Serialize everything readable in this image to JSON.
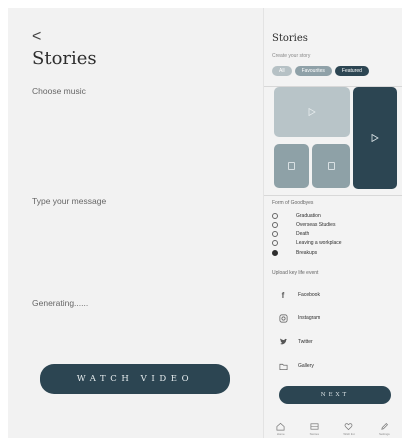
{
  "left": {
    "back_glyph": "<",
    "title": "Stories",
    "choose_music": "Choose music",
    "type_message": "Type your message",
    "generating": "Generating......",
    "watch_button": "WATCH VIDEO"
  },
  "right": {
    "title": "Stories",
    "subtitle": "Create your story",
    "tabs": [
      {
        "label": "All",
        "active": false
      },
      {
        "label": "Favourites",
        "active": false
      },
      {
        "label": "Featured",
        "active": true
      }
    ],
    "form_label": "Form of Goodbyes",
    "options": [
      {
        "label": "Graduation",
        "selected": false
      },
      {
        "label": "Overseas Studies",
        "selected": false
      },
      {
        "label": "Death",
        "selected": false
      },
      {
        "label": "Leaving a workplace",
        "selected": false
      },
      {
        "label": "Breakups",
        "selected": true
      }
    ],
    "upload_label": "Upload key life event",
    "socials": [
      {
        "label": "Facebook",
        "icon": "facebook-icon"
      },
      {
        "label": "Instagram",
        "icon": "instagram-icon"
      },
      {
        "label": "Twitter",
        "icon": "twitter-icon"
      },
      {
        "label": "Gallery",
        "icon": "folder-icon"
      }
    ],
    "next_button": "NEXT",
    "nav": [
      {
        "label": "Home",
        "icon": "home-icon"
      },
      {
        "label": "Stories",
        "icon": "stories-icon"
      },
      {
        "label": "Wish list",
        "icon": "heart-icon"
      },
      {
        "label": "Settings",
        "icon": "pencil-icon"
      }
    ]
  },
  "colors": {
    "accent": "#2c4552",
    "tile_light": "#b8c4c8",
    "tile_mid": "#8ea1a7",
    "background": "#f2f2f2"
  }
}
